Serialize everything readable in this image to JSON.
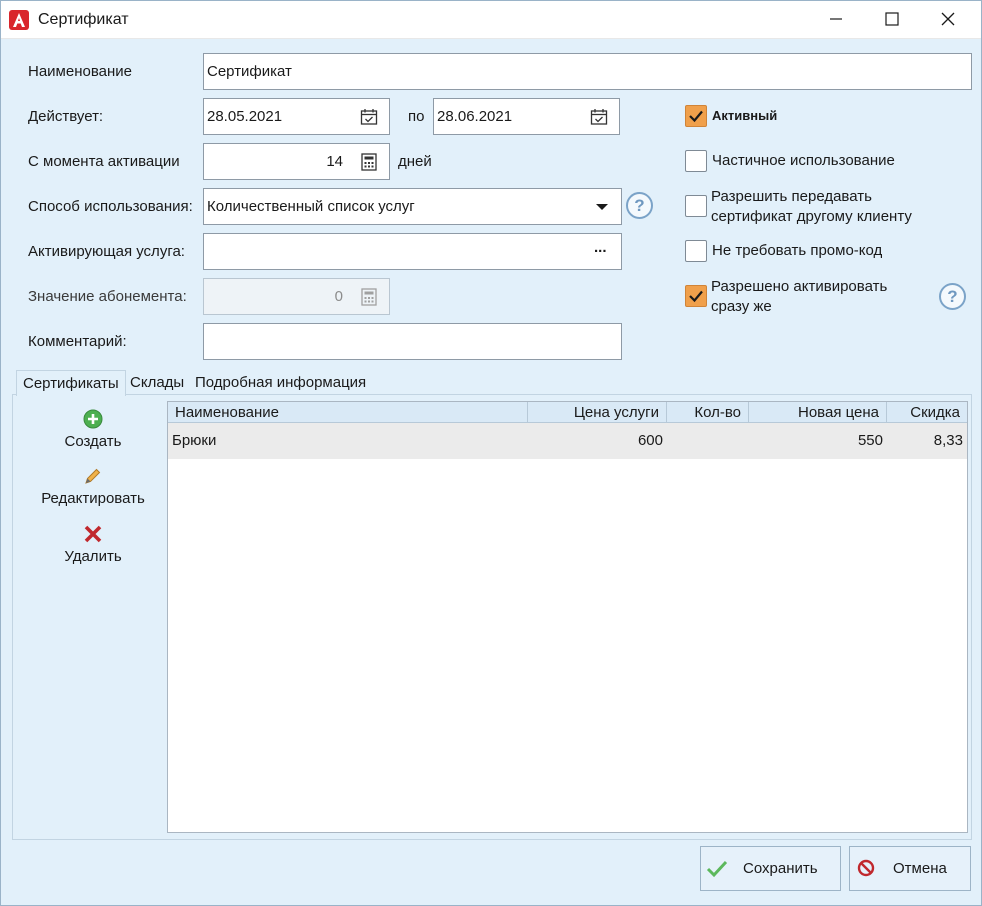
{
  "window": {
    "title": "Сертификат",
    "app_icon": "app-logo-a-icon"
  },
  "form": {
    "name_label": "Наименование",
    "name_value": "Сертификат",
    "valid_label": "Действует:",
    "date_from": "28.05.2021",
    "date_sep": "по",
    "date_to": "28.06.2021",
    "activation_label": "С момента активации",
    "activation_days": "14",
    "days_unit": "дней",
    "usage_label": "Способ использования:",
    "usage_value": "Количественный список услуг",
    "activating_service_label": "Активирующая услуга:",
    "activating_service_value": "",
    "activating_service_button": "...",
    "subscription_label": "Значение абонемента:",
    "subscription_value": "0",
    "comment_label": "Комментарий:",
    "comment_value": ""
  },
  "options": {
    "active": {
      "label": "Активный",
      "checked": true
    },
    "partial_use": {
      "label": "Частичное использование",
      "checked": false
    },
    "transfer": {
      "label_line1": "Разрешить передавать",
      "label_line2": "сертификат другому клиенту",
      "checked": false
    },
    "no_promo": {
      "label": "Не требовать промо-код",
      "checked": false
    },
    "activate_immediately": {
      "label_line1": "Разрешено активировать",
      "label_line2": "сразу же",
      "checked": true
    }
  },
  "help_glyph": "?",
  "tabs": [
    {
      "label": "Сертификаты",
      "active": true
    },
    {
      "label": "Склады",
      "active": false
    },
    {
      "label": "Подробная информация",
      "active": false
    }
  ],
  "toolbar": {
    "create_label": "Создать",
    "edit_label": "Редактировать",
    "delete_label": "Удалить"
  },
  "table": {
    "columns": [
      "Наименование",
      "Цена услуги",
      "Кол-во",
      "Новая цена",
      "Скидка"
    ],
    "rows": [
      {
        "name": "Брюки",
        "price": "600",
        "qty": "",
        "new_price": "550",
        "discount": "8,33"
      }
    ]
  },
  "buttons": {
    "save_label": "Сохранить",
    "cancel_label": "Отмена"
  },
  "colors": {
    "accent_orange": "#f0a04b",
    "background": "#e2f0fa",
    "header": "#d9e9f6",
    "save_green": "#5cb85c",
    "cancel_red": "#c0282d"
  }
}
